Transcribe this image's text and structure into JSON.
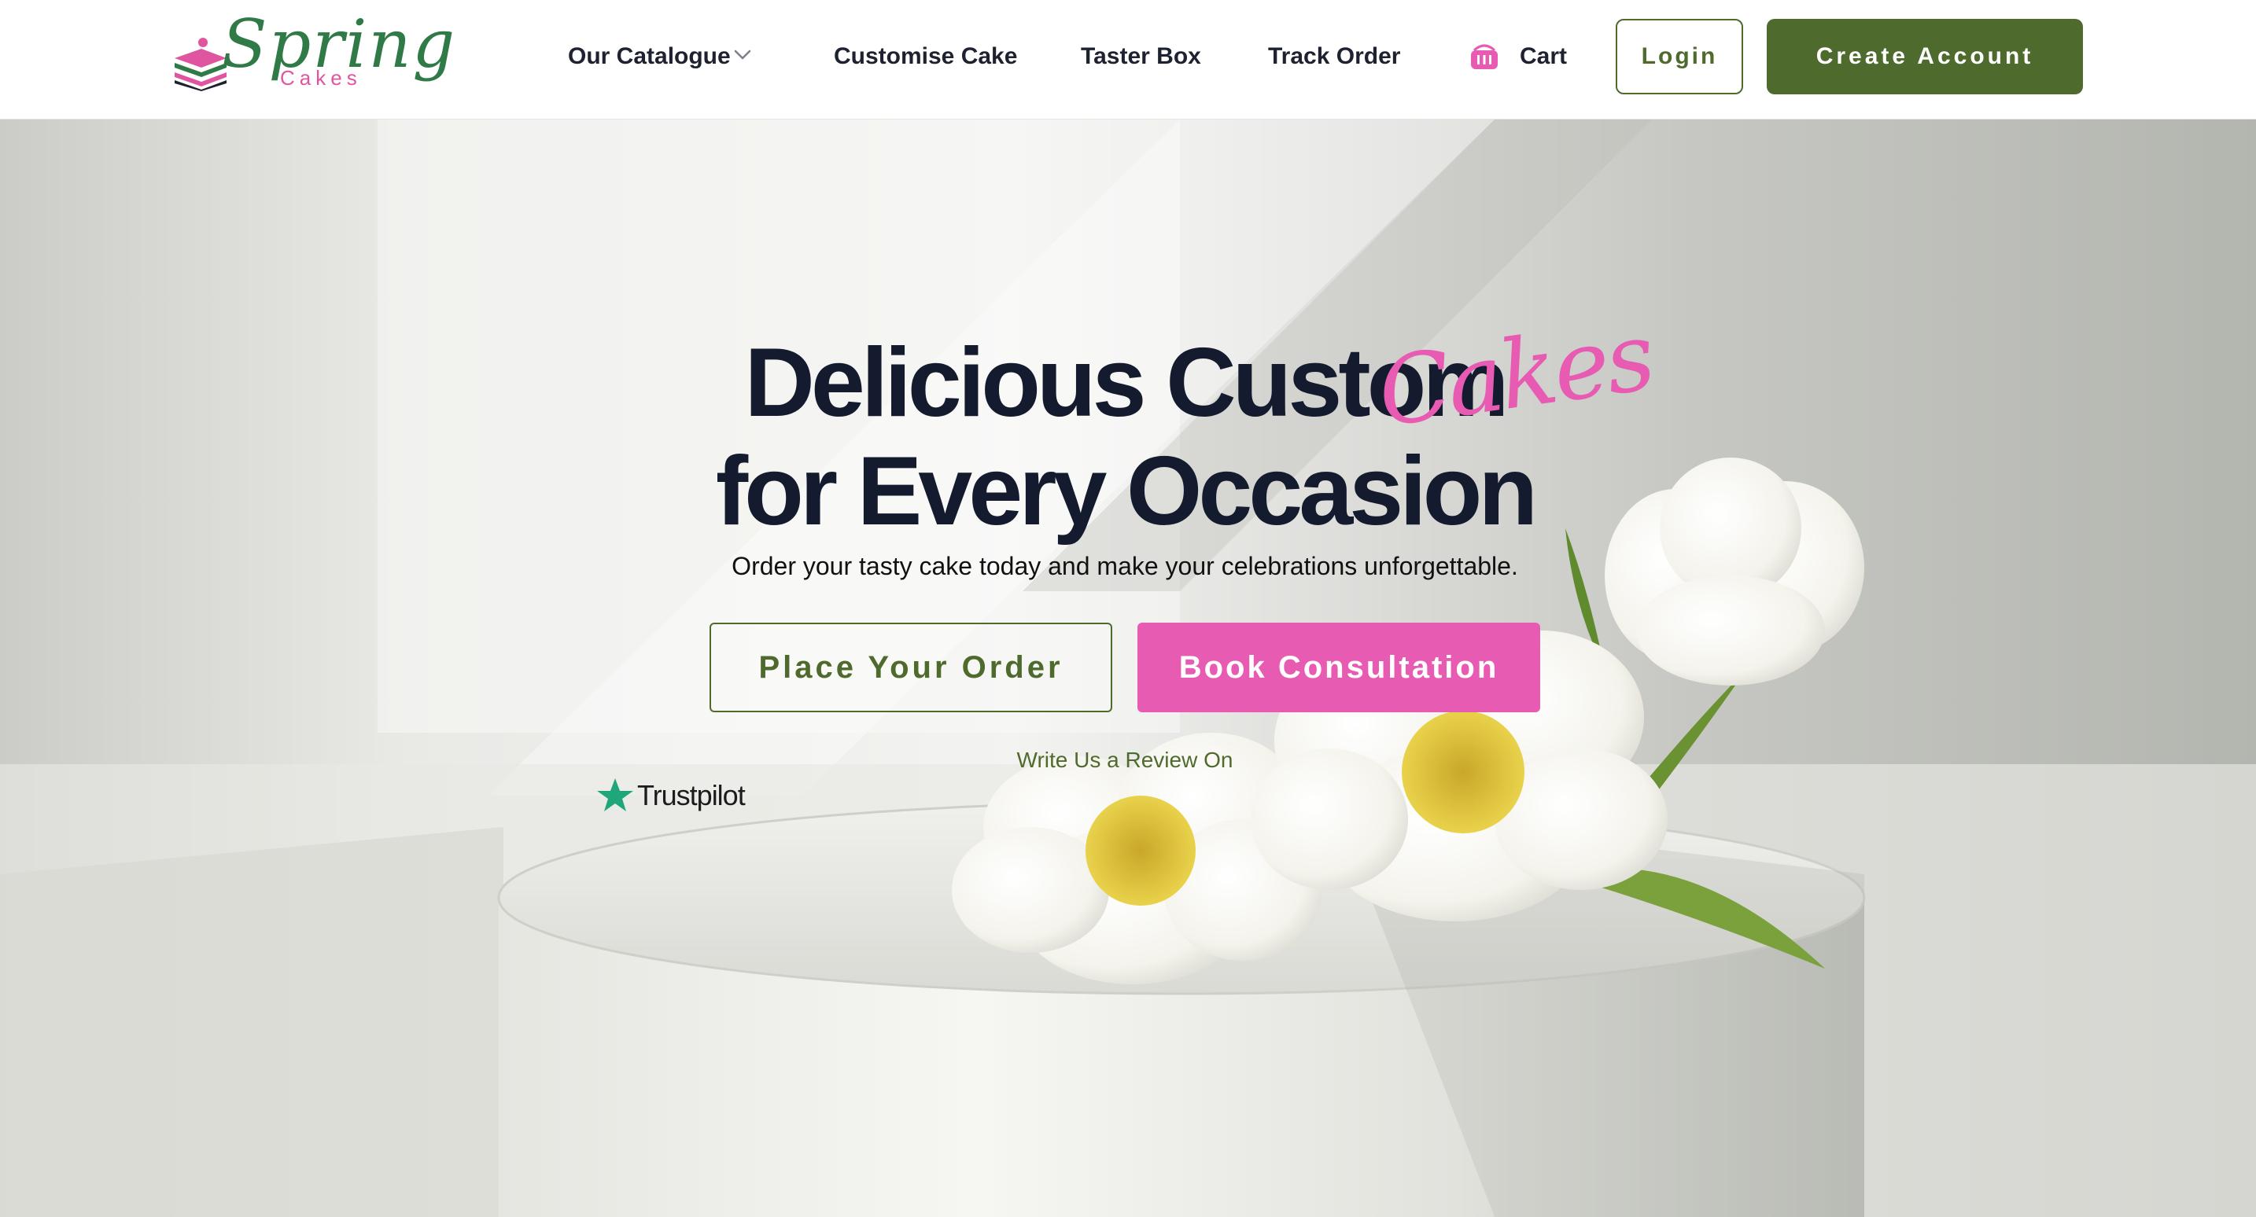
{
  "brand": {
    "name_script": "Spring",
    "name_sub": "Cakes",
    "colors": {
      "primary_green": "#4f6a2d",
      "accent_pink": "#e85bb3",
      "logo_green": "#2f7a46"
    }
  },
  "nav": {
    "catalogue": "Our Catalogue",
    "customise": "Customise Cake",
    "taster": "Taster Box",
    "track": "Track Order",
    "cart": "Cart",
    "catalogue_icon": "chevron-down-icon",
    "cart_icon": "basket-icon"
  },
  "auth": {
    "login": "Login",
    "create_account": "Create Account"
  },
  "hero": {
    "title_line1": "Delicious Custom",
    "title_line2": "for Every Occasion",
    "title_script": "Cakes",
    "subtitle": "Order your tasty cake today and make your celebrations unforgettable.",
    "primary_cta": "Place Your Order",
    "secondary_cta": "Book Consultation",
    "review_prompt": "Write Us a Review On",
    "review_brand": "Trustpilot",
    "review_icon": "star-icon",
    "image": "white cake with white flowers"
  }
}
